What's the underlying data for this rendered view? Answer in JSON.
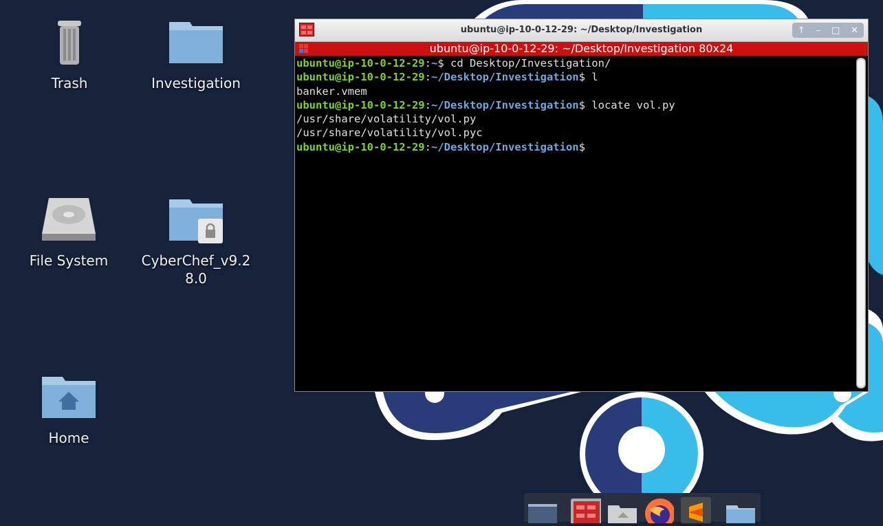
{
  "desktop": {
    "icons": [
      {
        "label": "Trash"
      },
      {
        "label": "Investigation"
      },
      {
        "label": "File System"
      },
      {
        "label": "CyberChef_v9.28.0"
      },
      {
        "label": "Home"
      }
    ]
  },
  "terminal": {
    "window_title": "ubuntu@ip-10-0-12-29: ~/Desktop/Investigation",
    "tab_title": "ubuntu@ip-10-0-12-29: ~/Desktop/Investigation 80x24",
    "controls": [
      "↑",
      "–",
      "□",
      "✕"
    ],
    "lines": [
      {
        "user": "ubuntu@ip-10-0-12-29",
        "sep": ":",
        "path": "~",
        "prompt": "$ ",
        "cmd": "cd Desktop/Investigation/"
      },
      {
        "user": "ubuntu@ip-10-0-12-29",
        "sep": ":",
        "path": "~/Desktop/Investigation",
        "prompt": "$ ",
        "cmd": "l"
      },
      {
        "out": "banker.vmem"
      },
      {
        "user": "ubuntu@ip-10-0-12-29",
        "sep": ":",
        "path": "~/Desktop/Investigation",
        "prompt": "$ ",
        "cmd": "locate vol.py"
      },
      {
        "out": "/usr/share/volatility/vol.py"
      },
      {
        "out": "/usr/share/volatility/vol.pyc"
      },
      {
        "user": "ubuntu@ip-10-0-12-29",
        "sep": ":",
        "path": "~/Desktop/Investigation",
        "prompt": "$",
        "cmd": ""
      }
    ]
  },
  "dock": {
    "items": [
      "desktop-icon",
      "terminal-icon",
      "home-folder-icon",
      "firefox-icon",
      "sublime-text-icon",
      "folder-icon"
    ]
  },
  "colors": {
    "background": "#16213a",
    "prompt_user": "#7ed321",
    "prompt_path": "#6fa8dc",
    "tab_bar": "#cc1010",
    "wallpaper_dark": "#2a3b7a",
    "wallpaper_light": "#38bdea"
  }
}
